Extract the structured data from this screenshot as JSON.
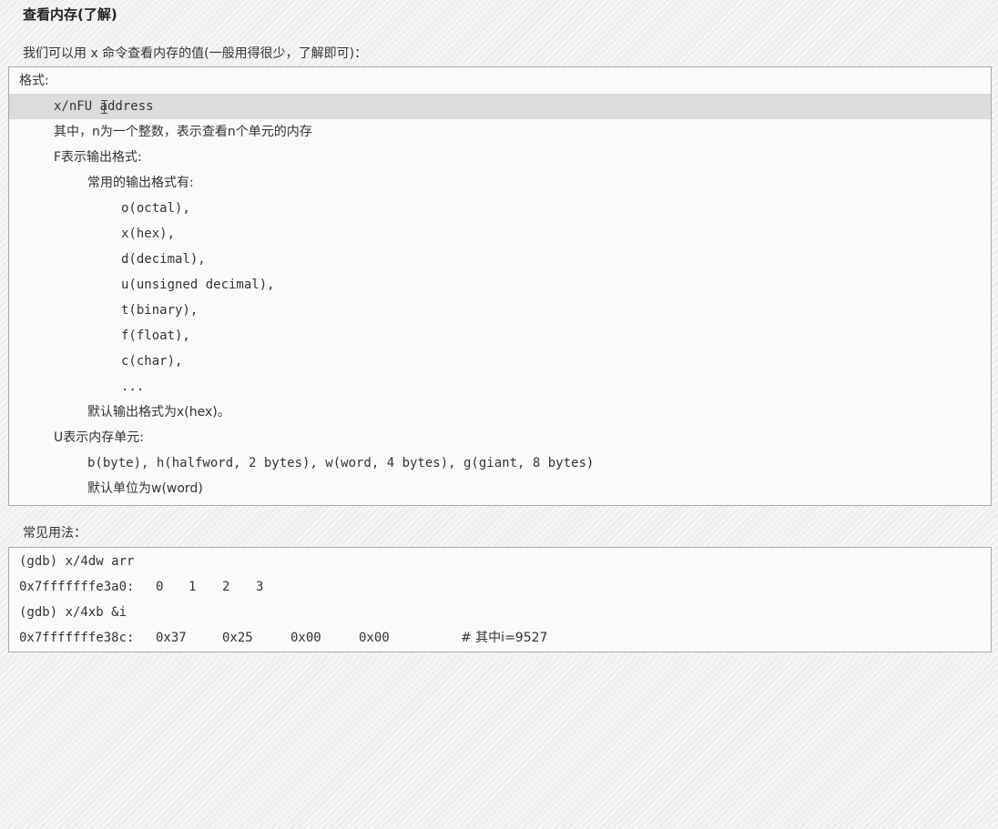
{
  "heading": "查看内存(了解)",
  "intro": "我们可以用 x 命令查看内存的值(一般用得很少，了解即可)：",
  "format_box": {
    "lines": [
      "格式:",
      "x/nFU address",
      "其中，n为一个整数，表示查看n个单元的内存",
      "F表示输出格式:",
      "常用的输出格式有:",
      "o(octal),",
      "x(hex),",
      "d(decimal),",
      "u(unsigned decimal),",
      "t(binary),",
      "f(float),",
      "c(char),",
      "...",
      "默认输出格式为x(hex)。",
      "U表示内存单元:",
      "b(byte), h(halfword, 2 bytes), w(word, 4 bytes), g(giant, 8 bytes)",
      "默认单位为w(word)"
    ]
  },
  "usage_label": "常见用法：",
  "usage_box": {
    "line1": "(gdb) x/4dw arr",
    "line2": {
      "addr": "0x7fffffffe3a0:",
      "v1": "0",
      "v2": "1",
      "v3": "2",
      "v4": "3"
    },
    "line3": "(gdb) x/4xb &i",
    "line4": {
      "addr": "0x7fffffffe38c:",
      "v1": "0x37",
      "v2": "0x25",
      "v3": "0x00",
      "v4": "0x00",
      "comment": "# 其中i=9527"
    }
  }
}
